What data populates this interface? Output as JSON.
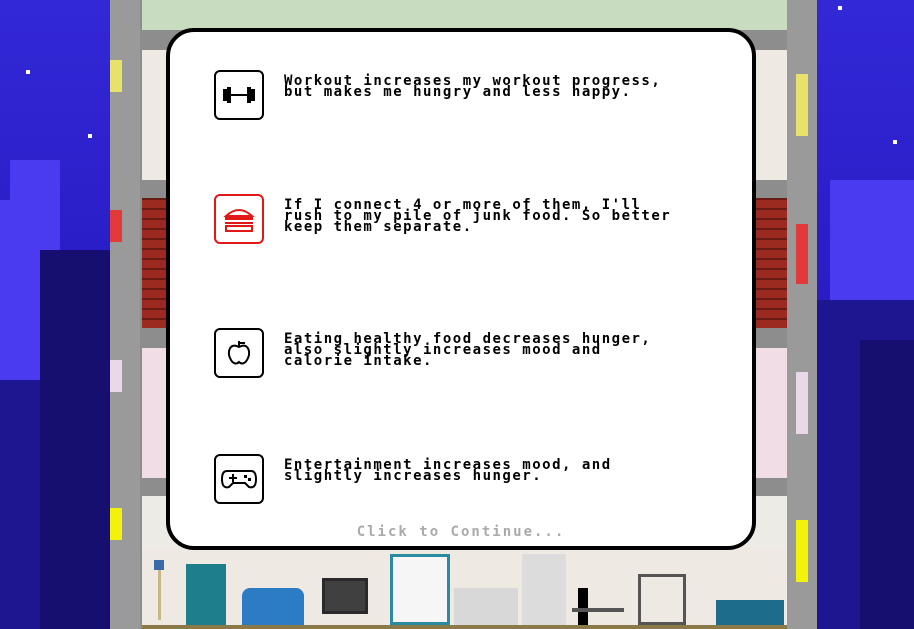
{
  "dialog": {
    "tips": [
      {
        "icon": "dumbbell-icon",
        "text": "Workout increases my workout progress,\nbut makes me hungry and less happy."
      },
      {
        "icon": "burger-icon",
        "text": "If I connect 4 or more of them, I'll\nrush to my pile of junk food. So better\nkeep them separate."
      },
      {
        "icon": "apple-icon",
        "text": "Eating healthy food decreases hunger,\nalso slightly increases mood and\ncalorie intake."
      },
      {
        "icon": "gamepad-icon",
        "text": "Entertainment increases mood, and\nslightly increases hunger."
      }
    ],
    "continue_label": "Click to Continue..."
  },
  "colors": {
    "sky": "#2a1ec8",
    "junk_food_accent": "#e01818",
    "dialog_border": "#000000",
    "continue_text": "#aaaaaa"
  }
}
